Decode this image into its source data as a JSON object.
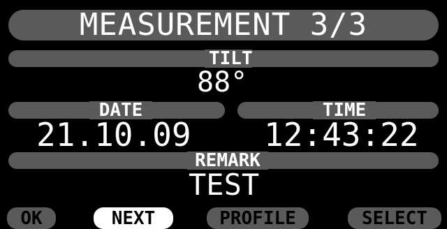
{
  "screen": {
    "title": "MEASUREMENT 3/3"
  },
  "tilt": {
    "label": "TILT",
    "value": "88°"
  },
  "date": {
    "label": "DATE",
    "value": "21.10.09"
  },
  "time": {
    "label": "TIME",
    "value": "12:43:22"
  },
  "remark": {
    "label": "REMARK",
    "value": "TEST"
  },
  "softkeys": {
    "ok": "OK",
    "next": "NEXT",
    "profile": "PROFILE",
    "select": "SELECT",
    "active": "next"
  },
  "colors": {
    "background": "#000000",
    "bar": "#5a5a5a",
    "text": "#ffffff",
    "highlight": "#ffffff"
  }
}
